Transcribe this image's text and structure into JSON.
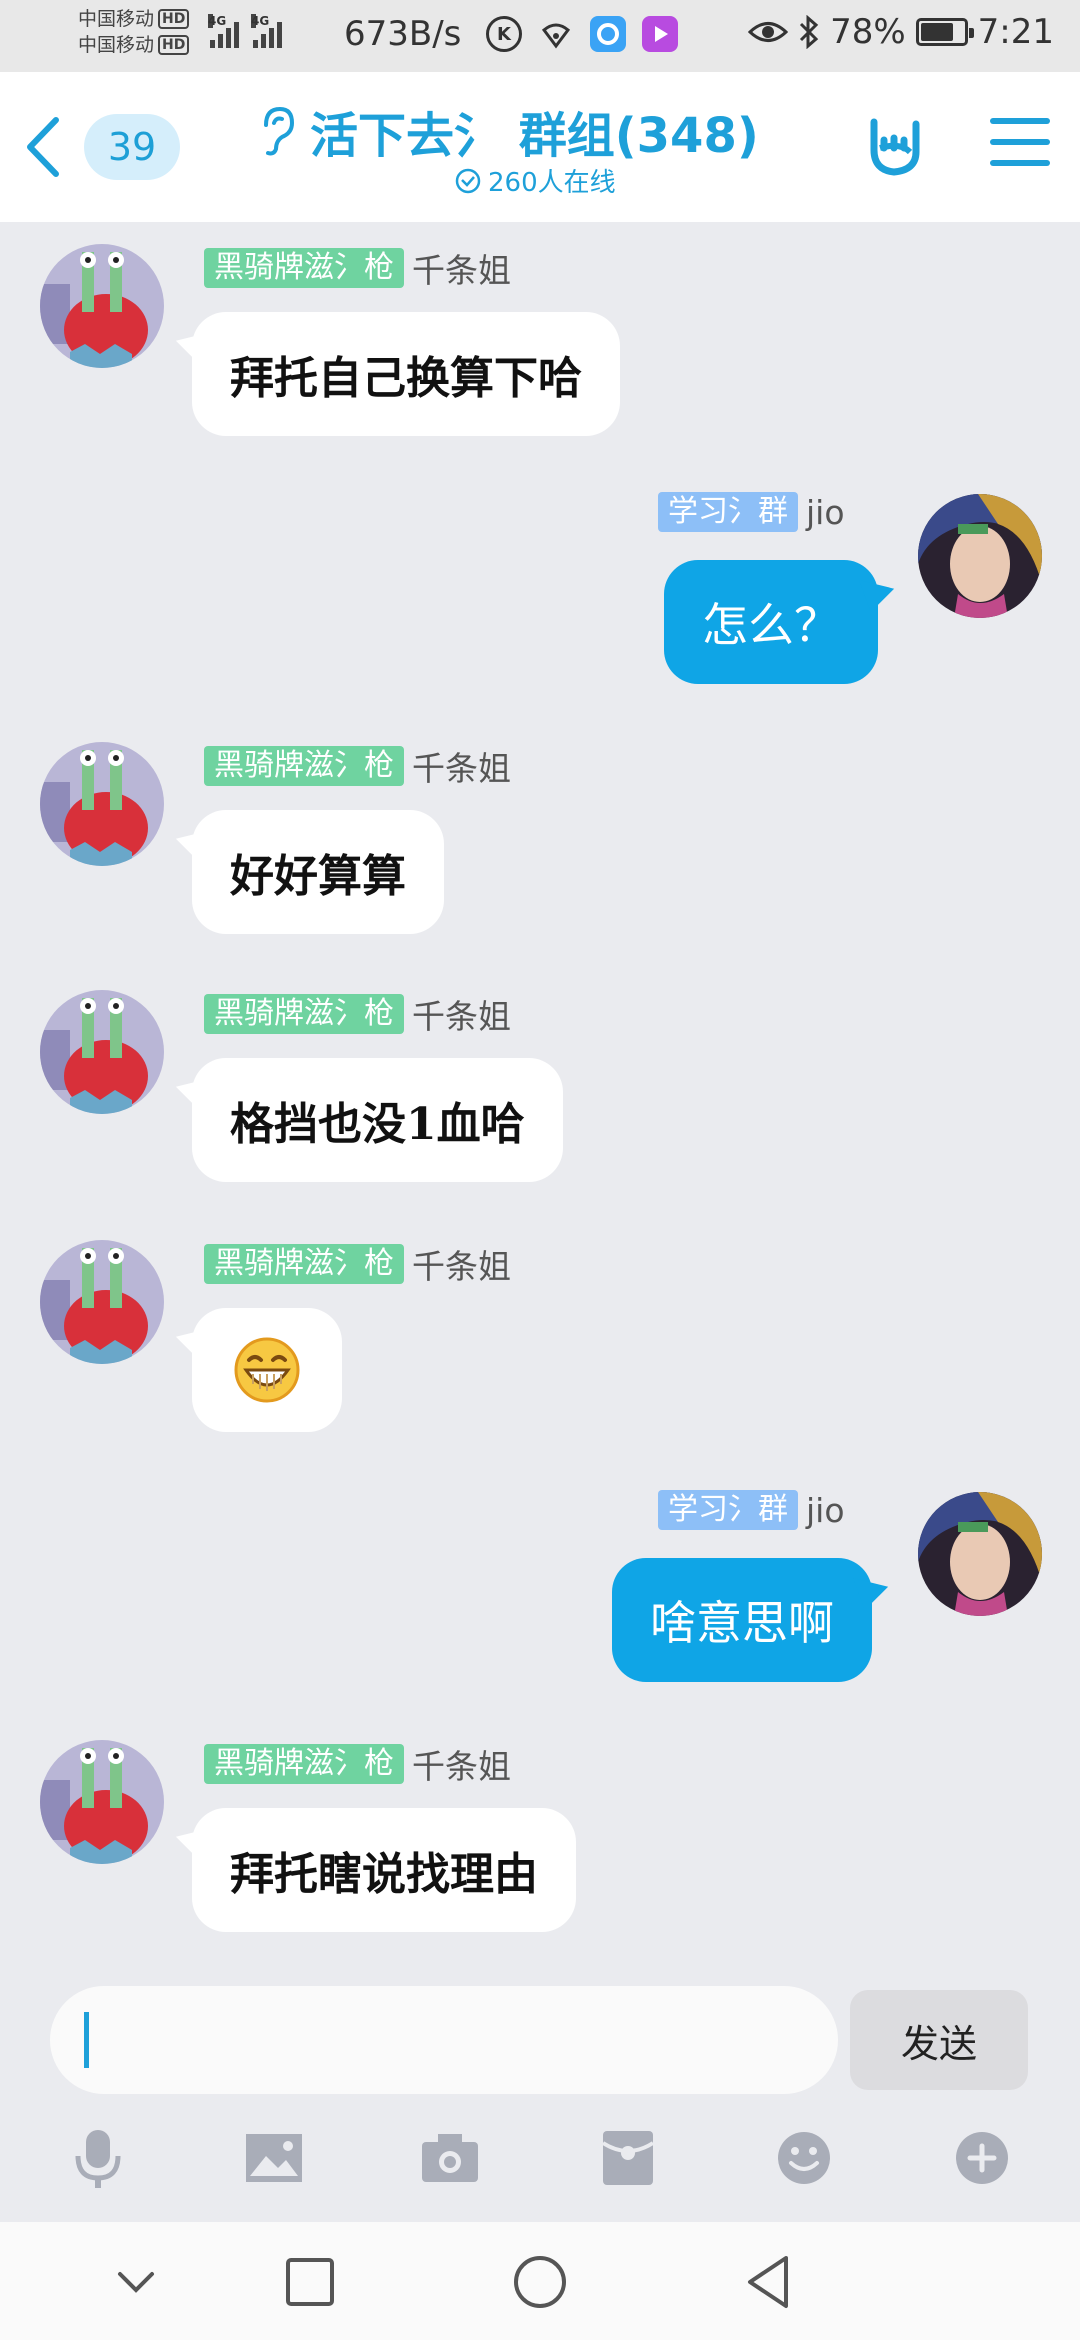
{
  "status_bar": {
    "carrier1": "中国移动",
    "carrier2": "中国移动",
    "hd": "HD",
    "net1": "4G",
    "net2": "4G",
    "speed": "673B/s",
    "battery": "78%",
    "battery_level": 0.78,
    "time": "7:21"
  },
  "header": {
    "back_count": "39",
    "title": "活下去氵 群组(348)",
    "online": "260人在线"
  },
  "messages": [
    {
      "side": "left",
      "tag": "黑骑牌滋氵枪",
      "nick": "千条姐",
      "text": "拜托自己换算下哈"
    },
    {
      "side": "right",
      "tag": "学习氵群",
      "nick": "jio",
      "text": "怎么？"
    },
    {
      "side": "left",
      "tag": "黑骑牌滋氵枪",
      "nick": "千条姐",
      "text": "好好算算"
    },
    {
      "side": "left",
      "tag": "黑骑牌滋氵枪",
      "nick": "千条姐",
      "text": "格挡也没1血哈"
    },
    {
      "side": "left",
      "tag": "黑骑牌滋氵枪",
      "nick": "千条姐",
      "text": ""
    },
    {
      "side": "right",
      "tag": "学习氵群",
      "nick": "jio",
      "text": "啥意思啊"
    },
    {
      "side": "left",
      "tag": "黑骑牌滋氵枪",
      "nick": "千条姐",
      "text": "拜托瞎说找理由"
    }
  ],
  "input": {
    "value": "",
    "send_label": "发送"
  },
  "toolbar_icons": [
    "microphone-icon",
    "image-icon",
    "camera-icon",
    "red-packet-icon",
    "emoji-icon",
    "plus-icon"
  ],
  "colors": {
    "accent": "#1ea0d9",
    "right_bubble": "#0fa5e6",
    "green_tag": "#6fd3a0",
    "blue_tag": "#8dbff7",
    "chat_bg": "#eaebef"
  }
}
